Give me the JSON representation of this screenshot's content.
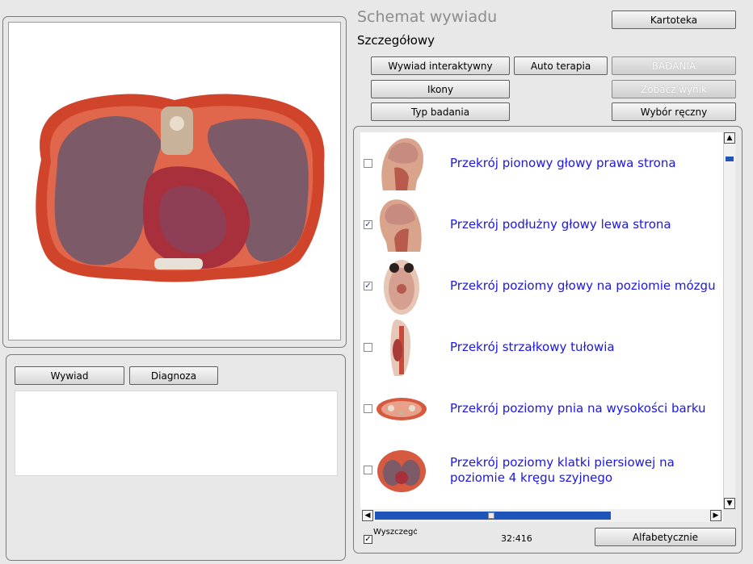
{
  "header": {
    "title": "Schemat wywiadu",
    "subtitle": "Szczegółowy"
  },
  "buttons": {
    "kartoteka": "Kartoteka",
    "wywiad_interaktywny": "Wywiad interaktywny",
    "auto_terapia": "Auto terapia",
    "badania": "BADANIA",
    "ikony": "Ikony",
    "zobacz_wynik": "Zobacz wynik",
    "typ_badania": "Typ badania",
    "wybor_reczny": "Wybór ręczny",
    "wywiad": "Wywiad",
    "diagnoza": "Diagnoza",
    "alfabetycznie": "Alfabetycznie"
  },
  "list": {
    "items": [
      {
        "label": "Przekrój pionowy  głowy prawa strona",
        "checked": false,
        "thumb": "sagittal-head-right-icon"
      },
      {
        "label": "Przekrój podłużny głowy lewa strona",
        "checked": true,
        "thumb": "sagittal-head-left-icon"
      },
      {
        "label": "Przekrój poziomy głowy  na poziomie mózgu",
        "checked": true,
        "thumb": "axial-brain-icon"
      },
      {
        "label": "Przekrój strzałkowy tułowia",
        "checked": false,
        "thumb": "sagittal-torso-icon"
      },
      {
        "label": "Przekrój poziomy pnia na wysokości barku",
        "checked": false,
        "thumb": "axial-shoulder-icon"
      },
      {
        "label": "Przekrój poziomy klatki piersiowej na poziomie 4 kręgu szyjnego",
        "checked": false,
        "thumb": "axial-chest-icon"
      }
    ]
  },
  "footer": {
    "checkbox_label": "Wyszczegół",
    "checkbox_checked": true,
    "counter": "32:416"
  },
  "colors": {
    "link": "#1c16e6",
    "panel_bg": "#e8e8e8",
    "scroll_thumb": "#1f54b8"
  }
}
